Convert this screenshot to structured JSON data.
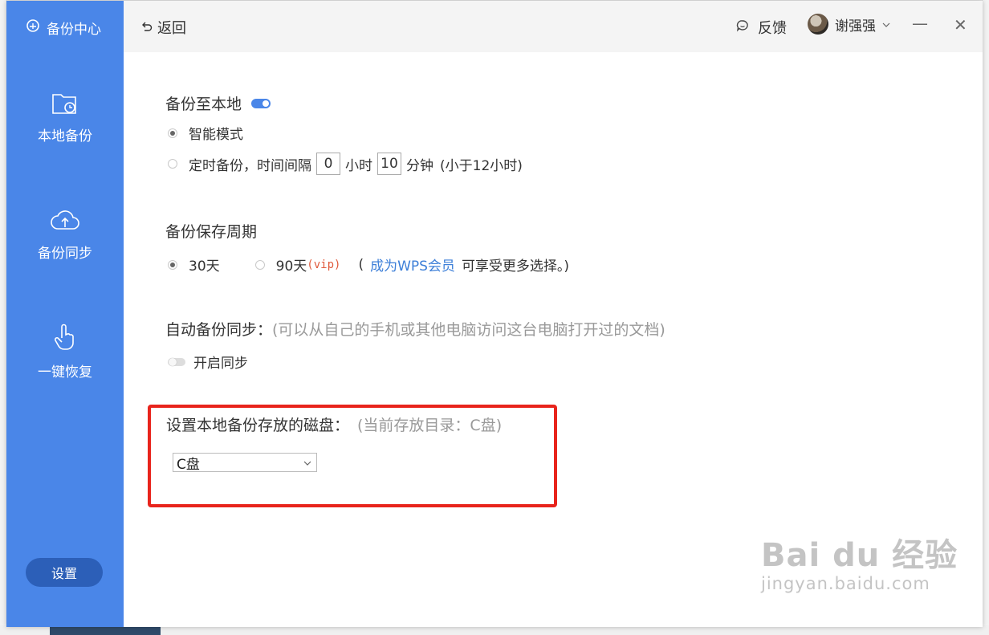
{
  "sidebar": {
    "brand": "备份中心",
    "items": [
      {
        "label": "本地备份",
        "icon": "folder-clock-icon"
      },
      {
        "label": "备份同步",
        "icon": "cloud-upload-icon"
      },
      {
        "label": "一键恢复",
        "icon": "hand-pointer-icon"
      }
    ],
    "settings_label": "设置"
  },
  "titlebar": {
    "back_label": "返回",
    "feedback_label": "反馈",
    "user_name": "谢强强",
    "minimize": "—",
    "close": "✕"
  },
  "local_backup": {
    "title": "备份至本地",
    "enabled": true,
    "smart_mode_label": "智能模式",
    "timed_label": "定时备份，时间间隔",
    "hours_value": "0",
    "hours_unit": "小时",
    "minutes_value": "10",
    "minutes_unit": "分钟",
    "limit_note": "(小于12小时)"
  },
  "retention": {
    "title": "备份保存周期",
    "option_30": "30天",
    "option_90": "90天",
    "vip_tag": "(vip)",
    "note_open": "(",
    "member_link": "成为WPS会员",
    "note_close": "可享受更多选择。)"
  },
  "auto_sync": {
    "title": "自动备份同步：",
    "hint": "(可以从自己的手机或其他电脑访问这台电脑打开过的文档)",
    "toggle_label": "开启同步",
    "enabled": false
  },
  "disk": {
    "title": "设置本地备份存放的磁盘：",
    "hint": "(当前存放目录：C盘)",
    "selected": "C盘"
  },
  "watermark": {
    "top": "Bai du 经验",
    "bottom": "jingyan.baidu.com"
  },
  "colors": {
    "sidebar": "#4a86e8",
    "settings_button": "#2c5fb8",
    "highlight": "#e8241c",
    "link": "#3d7fd8",
    "vip": "#e05a3c"
  }
}
